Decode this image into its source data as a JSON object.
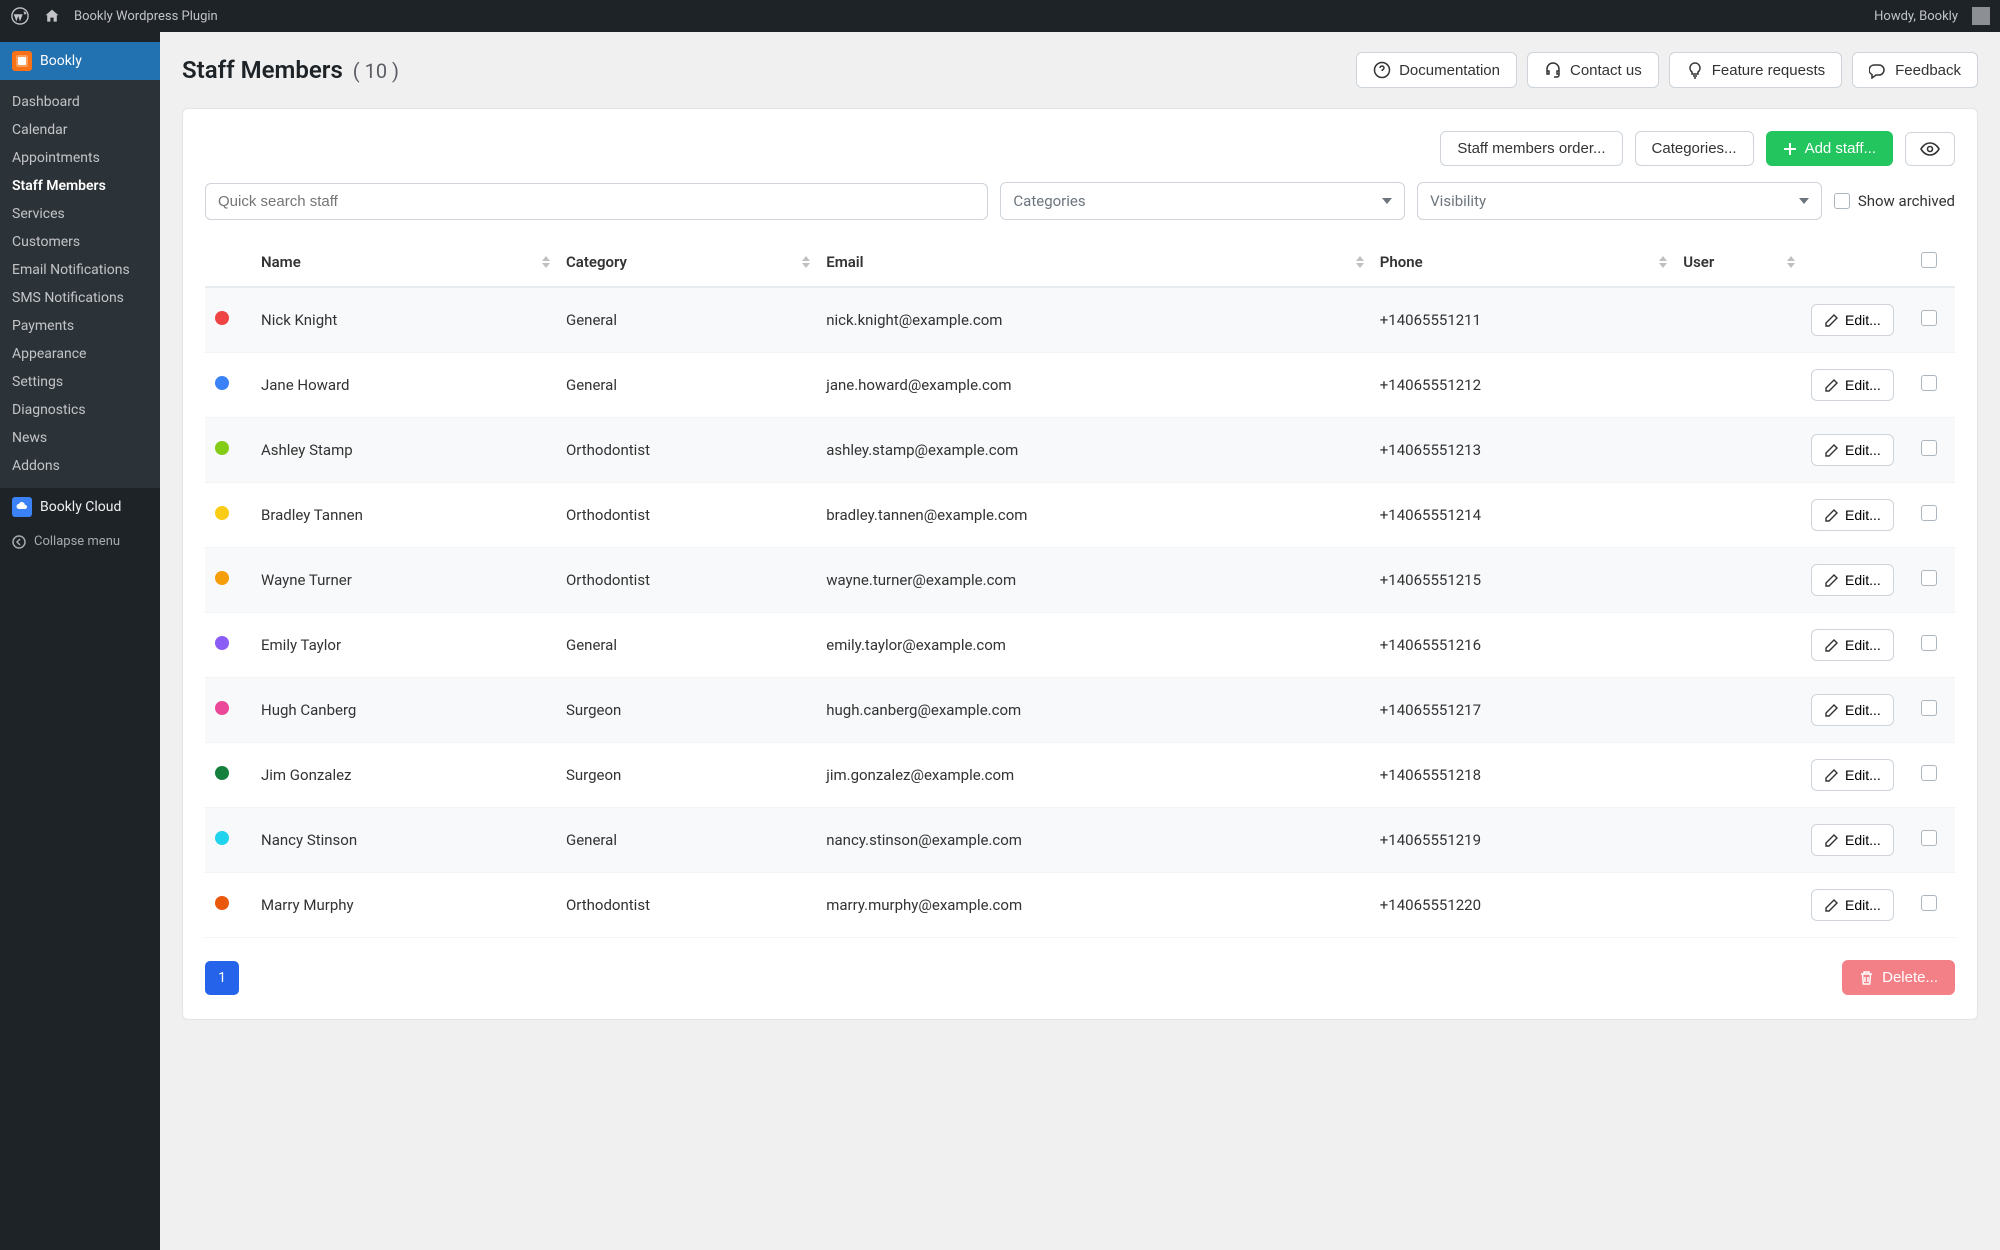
{
  "adminbar": {
    "site_title": "Bookly Wordpress Plugin",
    "howdy": "Howdy, Bookly"
  },
  "sidebar": {
    "plugin_label": "Bookly",
    "submenu": [
      {
        "label": "Dashboard"
      },
      {
        "label": "Calendar"
      },
      {
        "label": "Appointments"
      },
      {
        "label": "Staff Members",
        "active": true
      },
      {
        "label": "Services"
      },
      {
        "label": "Customers"
      },
      {
        "label": "Email Notifications"
      },
      {
        "label": "SMS Notifications"
      },
      {
        "label": "Payments"
      },
      {
        "label": "Appearance"
      },
      {
        "label": "Settings"
      },
      {
        "label": "Diagnostics"
      },
      {
        "label": "News"
      },
      {
        "label": "Addons"
      }
    ],
    "cloud_label": "Bookly Cloud",
    "collapse_label": "Collapse menu"
  },
  "page": {
    "title": "Staff Members",
    "count_display": "( 10 )"
  },
  "header_buttons": {
    "documentation": "Documentation",
    "contact_us": "Contact us",
    "feature_requests": "Feature requests",
    "feedback": "Feedback"
  },
  "toolbar": {
    "staff_order": "Staff members order...",
    "categories": "Categories...",
    "add_staff": "Add staff..."
  },
  "filters": {
    "search_placeholder": "Quick search staff",
    "categories_placeholder": "Categories",
    "visibility_placeholder": "Visibility",
    "show_archived_label": "Show archived"
  },
  "table": {
    "columns": {
      "name": "Name",
      "category": "Category",
      "email": "Email",
      "phone": "Phone",
      "user": "User"
    },
    "edit_label": "Edit...",
    "rows": [
      {
        "color": "#ef4444",
        "name": "Nick Knight",
        "category": "General",
        "email": "nick.knight@example.com",
        "phone": "+14065551211"
      },
      {
        "color": "#3b82f6",
        "name": "Jane Howard",
        "category": "General",
        "email": "jane.howard@example.com",
        "phone": "+14065551212"
      },
      {
        "color": "#84cc16",
        "name": "Ashley Stamp",
        "category": "Orthodontist",
        "email": "ashley.stamp@example.com",
        "phone": "+14065551213"
      },
      {
        "color": "#facc15",
        "name": "Bradley Tannen",
        "category": "Orthodontist",
        "email": "bradley.tannen@example.com",
        "phone": "+14065551214"
      },
      {
        "color": "#f59e0b",
        "name": "Wayne Turner",
        "category": "Orthodontist",
        "email": "wayne.turner@example.com",
        "phone": "+14065551215"
      },
      {
        "color": "#8b5cf6",
        "name": "Emily Taylor",
        "category": "General",
        "email": "emily.taylor@example.com",
        "phone": "+14065551216"
      },
      {
        "color": "#ec4899",
        "name": "Hugh Canberg",
        "category": "Surgeon",
        "email": "hugh.canberg@example.com",
        "phone": "+14065551217"
      },
      {
        "color": "#15803d",
        "name": "Jim Gonzalez",
        "category": "Surgeon",
        "email": "jim.gonzalez@example.com",
        "phone": "+14065551218"
      },
      {
        "color": "#22d3ee",
        "name": "Nancy Stinson",
        "category": "General",
        "email": "nancy.stinson@example.com",
        "phone": "+14065551219"
      },
      {
        "color": "#ea580c",
        "name": "Marry Murphy",
        "category": "Orthodontist",
        "email": "marry.murphy@example.com",
        "phone": "+14065551220"
      }
    ]
  },
  "footer": {
    "page_number": "1",
    "delete_label": "Delete..."
  }
}
